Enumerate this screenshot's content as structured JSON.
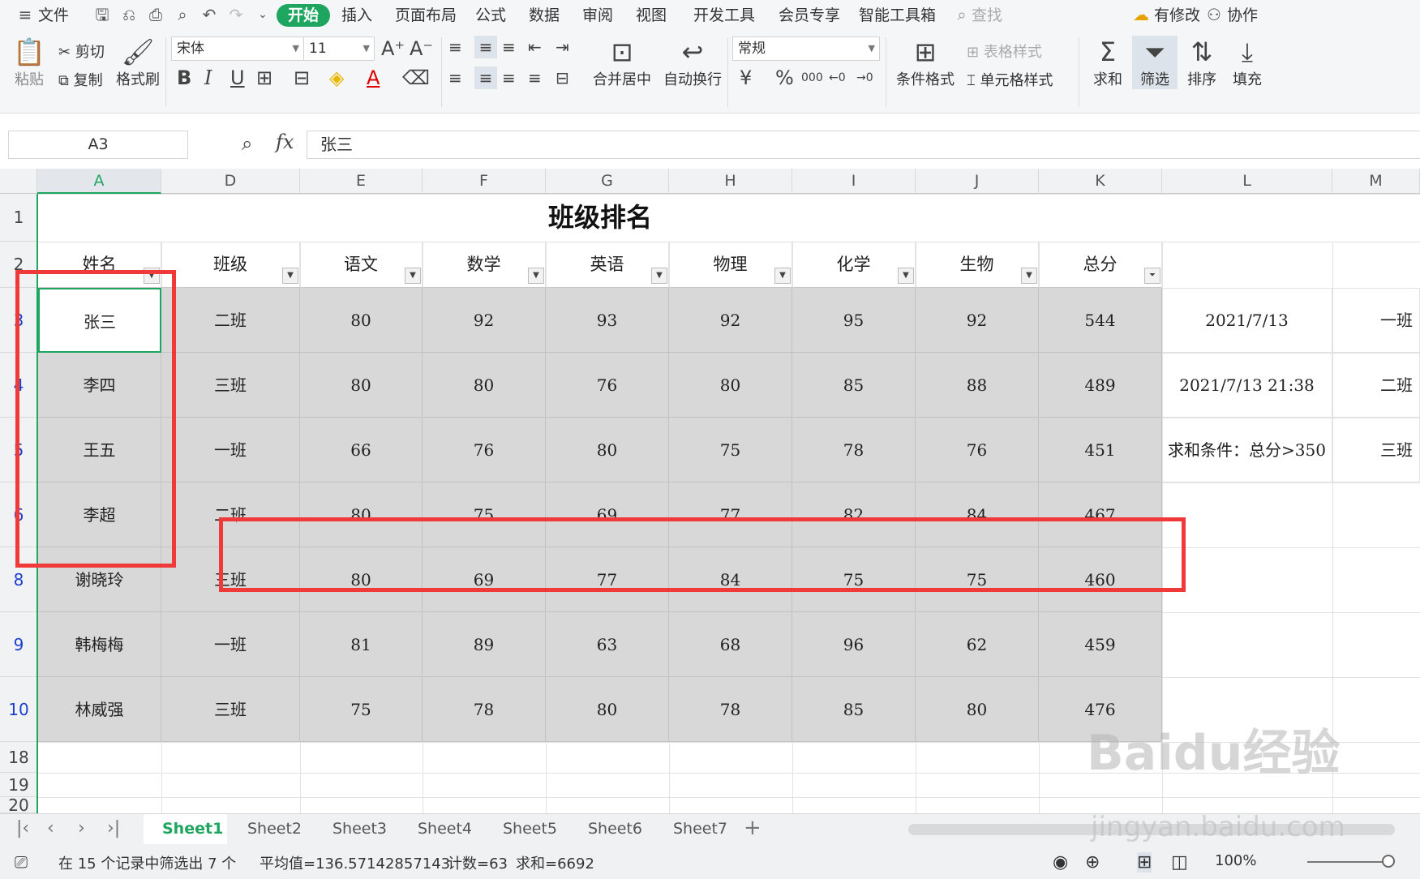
{
  "menubar": {
    "file": "文件",
    "tabs": [
      "开始",
      "插入",
      "页面布局",
      "公式",
      "数据",
      "审阅",
      "视图",
      "开发工具",
      "会员专享",
      "智能工具箱"
    ],
    "search": "查找",
    "has_changes": "有修改",
    "collab": "协作"
  },
  "ribbon": {
    "paste": "粘贴",
    "cut": "剪切",
    "copy": "复制",
    "format_painter": "格式刷",
    "font": "宋体",
    "size": "11",
    "merge": "合并居中",
    "wrap": "自动换行",
    "number_format": "常规",
    "cond_format": "条件格式",
    "table_style": "表格样式",
    "cell_style": "单元格样式",
    "sum": "求和",
    "filter": "筛选",
    "sort": "排序",
    "fill": "填充",
    "currency": "¥",
    "percent": "%",
    "thousand": "000"
  },
  "formula": {
    "namebox": "A3",
    "fx": "fx",
    "value": "张三"
  },
  "columns": [
    "A",
    "D",
    "E",
    "F",
    "G",
    "H",
    "I",
    "J",
    "K",
    "L",
    "M"
  ],
  "rows": [
    "1",
    "2",
    "3",
    "4",
    "5",
    "6",
    "8",
    "9",
    "10",
    "18",
    "19",
    "20"
  ],
  "title": "班级排名",
  "headers": [
    "姓名",
    "班级",
    "语文",
    "数学",
    "英语",
    "物理",
    "化学",
    "生物",
    "总分"
  ],
  "data": [
    [
      "张三",
      "二班",
      "80",
      "92",
      "93",
      "92",
      "95",
      "92",
      "544"
    ],
    [
      "李四",
      "三班",
      "80",
      "80",
      "76",
      "80",
      "85",
      "88",
      "489"
    ],
    [
      "王五",
      "一班",
      "66",
      "76",
      "80",
      "75",
      "78",
      "76",
      "451"
    ],
    [
      "李超",
      "二班",
      "80",
      "75",
      "69",
      "77",
      "82",
      "84",
      "467"
    ],
    [
      "谢晓玲",
      "三班",
      "80",
      "69",
      "77",
      "84",
      "75",
      "75",
      "460"
    ],
    [
      "韩梅梅",
      "一班",
      "81",
      "89",
      "63",
      "68",
      "96",
      "62",
      "459"
    ],
    [
      "林威强",
      "三班",
      "75",
      "78",
      "80",
      "78",
      "85",
      "80",
      "476"
    ]
  ],
  "side": {
    "l3": "2021/7/13",
    "l4": "2021/7/13 21:38",
    "l5": "求和条件：总分>350",
    "m3": "一班",
    "m4": "二班",
    "m5": "三班"
  },
  "sheets": [
    "Sheet1",
    "Sheet2",
    "Sheet3",
    "Sheet4",
    "Sheet5",
    "Sheet6",
    "Sheet7"
  ],
  "status": {
    "filter": "在 15 个记录中筛选出 7 个",
    "avg": "平均值=136.57142857143",
    "count": "计数=63",
    "sum": "求和=6692",
    "zoom": "100%"
  },
  "watermark": {
    "brand": "Baidu经验",
    "url": "jingyan.baidu.com"
  }
}
